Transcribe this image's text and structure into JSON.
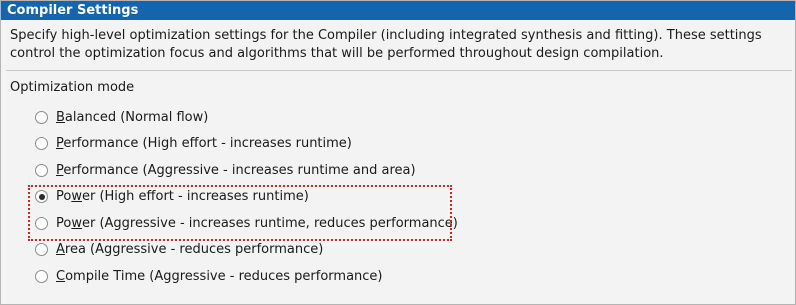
{
  "panel": {
    "title": "Compiler Settings",
    "description": "Specify high-level optimization settings for the Compiler (including integrated synthesis and fitting).  These settings control the optimization focus and algorithms that will be performed throughout design compilation.",
    "group_label": "Optimization mode"
  },
  "options": [
    {
      "mnemonic_before": "",
      "mnemonic": "B",
      "rest": "alanced (Normal flow)",
      "selected": false
    },
    {
      "mnemonic_before": "",
      "mnemonic": "P",
      "rest": "erformance (High effort - increases runtime)",
      "selected": false
    },
    {
      "mnemonic_before": "",
      "mnemonic": "P",
      "rest": "erformance (Aggressive - increases runtime and area)",
      "selected": false
    },
    {
      "mnemonic_before": "Po",
      "mnemonic": "w",
      "rest": "er (High effort - increases runtime)",
      "selected": true
    },
    {
      "mnemonic_before": "Po",
      "mnemonic": "w",
      "rest": "er (Aggressive - increases runtime, reduces performance)",
      "selected": false
    },
    {
      "mnemonic_before": "",
      "mnemonic": "A",
      "rest": "rea (Aggressive - reduces performance)",
      "selected": false
    },
    {
      "mnemonic_before": "",
      "mnemonic": "C",
      "rest": "ompile Time (Aggressive - reduces performance)",
      "selected": false
    }
  ],
  "colors": {
    "title_bar": "#1464ae",
    "highlight_border": "#e02020"
  }
}
